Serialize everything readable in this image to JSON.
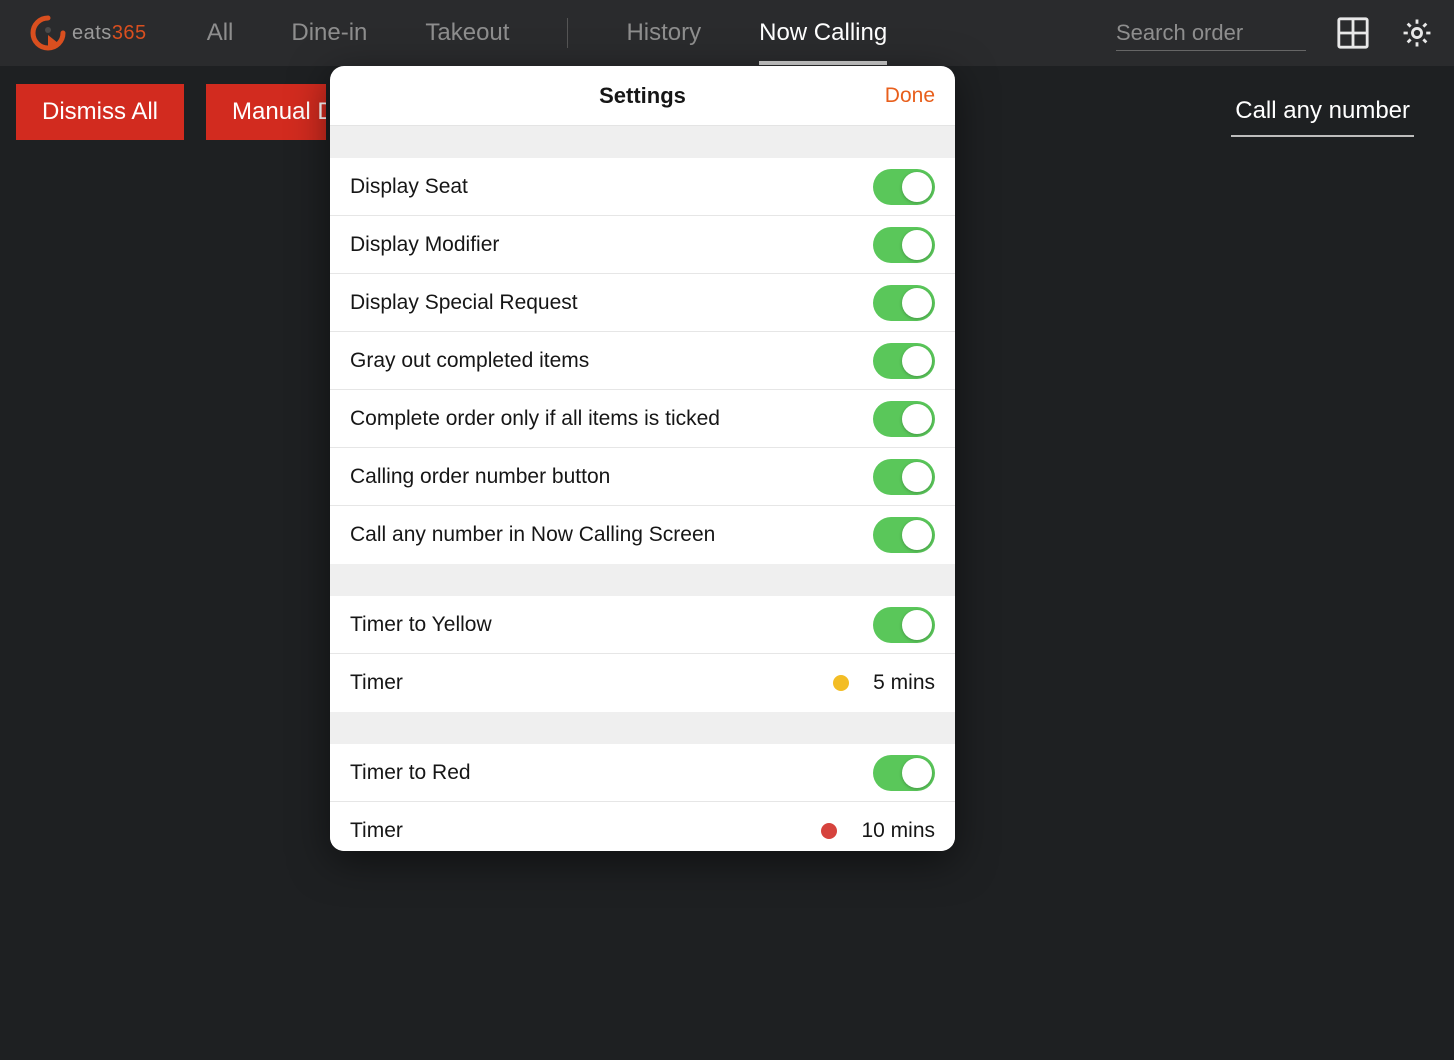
{
  "logo": {
    "text1": "eats",
    "text2": "365"
  },
  "nav": {
    "tabs": [
      "All",
      "Dine-in",
      "Takeout",
      "History",
      "Now Calling"
    ],
    "active_index": 4
  },
  "search": {
    "placeholder": "Search order"
  },
  "toolbar": {
    "dismiss_all": "Dismiss All",
    "manual_dismiss": "Manual Dismiss",
    "call_any_number": "Call any number"
  },
  "modal": {
    "title": "Settings",
    "done": "Done",
    "sections": [
      {
        "rows": [
          {
            "label": "Display Seat",
            "toggle": true
          },
          {
            "label": "Display Modifier",
            "toggle": true
          },
          {
            "label": "Display Special Request",
            "toggle": true
          },
          {
            "label": "Gray out completed items",
            "toggle": true
          },
          {
            "label": "Complete order only if all items is ticked",
            "toggle": true
          },
          {
            "label": "Calling order number button",
            "toggle": true
          },
          {
            "label": "Call any number in Now Calling Screen",
            "toggle": true
          }
        ]
      },
      {
        "rows": [
          {
            "label": "Timer to Yellow",
            "toggle": true
          },
          {
            "label": "Timer",
            "dot": "yellow",
            "value": "5 mins"
          }
        ]
      },
      {
        "rows": [
          {
            "label": "Timer to Red",
            "toggle": true
          },
          {
            "label": "Timer",
            "dot": "red",
            "value": "10 mins"
          }
        ]
      }
    ]
  }
}
